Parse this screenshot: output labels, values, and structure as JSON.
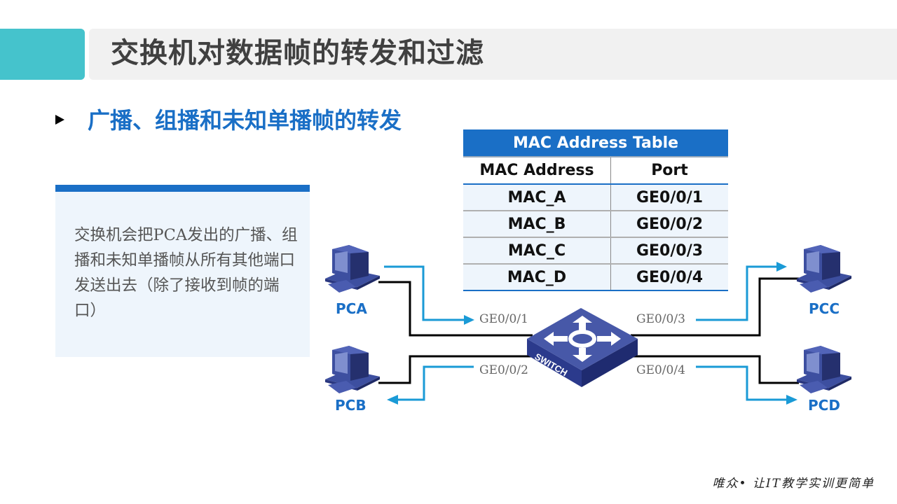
{
  "header": {
    "title": "交换机对数据帧的转发和过滤"
  },
  "section": {
    "bullet_icon": "triangle-right-icon",
    "subtitle": "广播、组播和未知单播帧的转发"
  },
  "note": {
    "text": "交换机会把PCA发出的广播、组播和未知单播帧从所有其他端口发送出去（除了接收到帧的端口）"
  },
  "mac_table": {
    "title": "MAC Address Table",
    "columns": [
      "MAC Address",
      "Port"
    ],
    "rows": [
      [
        "MAC_A",
        "GE0/0/1"
      ],
      [
        "MAC_B",
        "GE0/0/2"
      ],
      [
        "MAC_C",
        "GE0/0/3"
      ],
      [
        "MAC_D",
        "GE0/0/4"
      ]
    ]
  },
  "diagram": {
    "switch_label": "SWITCH",
    "hosts": [
      {
        "name": "PCA",
        "port": "GE0/0/1"
      },
      {
        "name": "PCB",
        "port": "GE0/0/2"
      },
      {
        "name": "PCC",
        "port": "GE0/0/3"
      },
      {
        "name": "PCD",
        "port": "GE0/0/4"
      }
    ],
    "colors": {
      "link": "#000000",
      "flow": "#1a9ad6",
      "device": "#3d4fa0"
    }
  },
  "footer": {
    "slogan": "唯众• 让IT教学实训更简单"
  }
}
